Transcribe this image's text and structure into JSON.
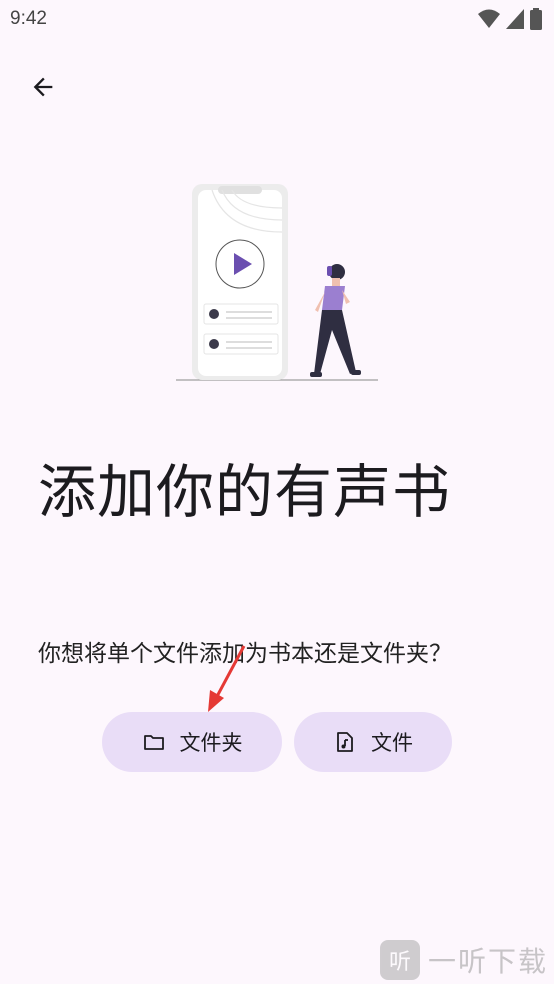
{
  "status": {
    "time": "9:42"
  },
  "main": {
    "title": "添加你的有声书",
    "subtitle": "你想将单个文件添加为书本还是文件夹？"
  },
  "buttons": {
    "folder_label": "文件夹",
    "file_label": "文件"
  },
  "watermark": {
    "logo_text": "听",
    "text": "一听下载"
  },
  "colors": {
    "background": "#fdf7fd",
    "button_bg": "#e9ddf7",
    "accent": "#6b4fb0",
    "annotation_arrow": "#e53935"
  }
}
